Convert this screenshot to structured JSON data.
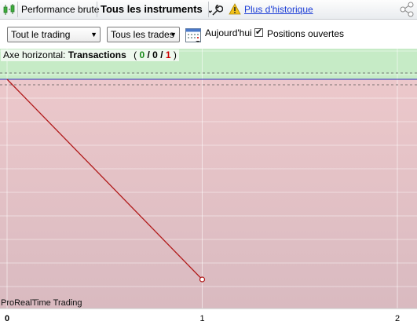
{
  "toolbar": {
    "title": "Performance brute",
    "instruments": "Tous les instruments",
    "history_link": "Plus d'historique"
  },
  "filters": {
    "trading_select": "Tout le trading",
    "trades_select": "Tous les trades",
    "today_label": "Aujourd'hui",
    "open_positions_label": "Positions ouvertes",
    "open_positions_checked": true
  },
  "chart": {
    "axis_label_prefix": "Axe horizontal:",
    "axis_label_main": "Transactions",
    "counts": {
      "open_paren": "(",
      "wins": "0",
      "sep1": "/",
      "neutral": "0",
      "sep2": "/",
      "losses": "1",
      "close_paren": ")"
    },
    "watermark": "ProRealTime Trading",
    "x_ticks": [
      "0",
      "1",
      "2"
    ],
    "colors": {
      "gain_zone": "#c6ebc6",
      "loss_zone": "#e7c3c6",
      "equity_line": "#b01a1a",
      "zero_line": "#3030c0",
      "win_count": "#1a8a1a",
      "loss_count": "#cc0000"
    }
  },
  "chart_data": {
    "type": "line",
    "x": [
      0,
      1
    ],
    "series": [
      {
        "values": [
          0,
          -1
        ]
      }
    ],
    "xlim": [
      0,
      2
    ],
    "x_ticks": [
      0,
      1,
      2
    ],
    "grid": true,
    "legend": "none"
  }
}
